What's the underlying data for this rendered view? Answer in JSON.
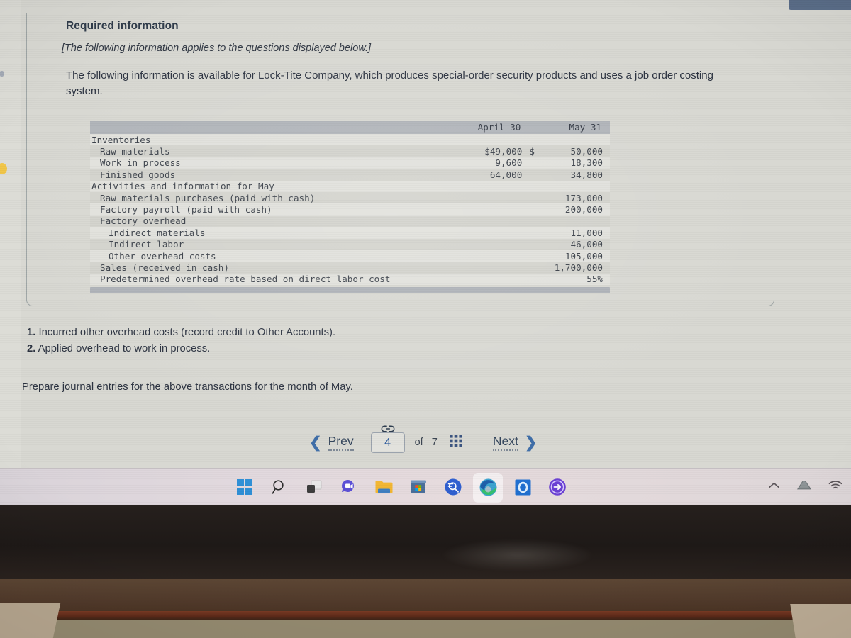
{
  "card": {
    "heading": "Required information",
    "note": "[The following information applies to the questions displayed below.]",
    "body": "The following information is available for Lock-Tite Company, which produces special-order security products and uses a job order costing system."
  },
  "table": {
    "columns": [
      "",
      "April 30",
      "May 31"
    ],
    "rows": [
      {
        "label": "Inventories",
        "indent": 0,
        "april": "",
        "may_currency": "",
        "may": ""
      },
      {
        "label": "Raw materials",
        "indent": 1,
        "april": "$49,000",
        "may_currency": "$",
        "may": "50,000"
      },
      {
        "label": "Work in process",
        "indent": 1,
        "april": "9,600",
        "may_currency": "",
        "may": "18,300"
      },
      {
        "label": "Finished goods",
        "indent": 1,
        "april": "64,000",
        "may_currency": "",
        "may": "34,800"
      },
      {
        "label": "Activities and information for May",
        "indent": 0,
        "april": "",
        "may_currency": "",
        "may": ""
      },
      {
        "label": "Raw materials purchases (paid with cash)",
        "indent": 1,
        "april": "",
        "may_currency": "",
        "may": "173,000"
      },
      {
        "label": "Factory payroll (paid with cash)",
        "indent": 1,
        "april": "",
        "may_currency": "",
        "may": "200,000"
      },
      {
        "label": "Factory overhead",
        "indent": 1,
        "april": "",
        "may_currency": "",
        "may": ""
      },
      {
        "label": "Indirect materials",
        "indent": 2,
        "april": "",
        "may_currency": "",
        "may": "11,000"
      },
      {
        "label": "Indirect labor",
        "indent": 2,
        "april": "",
        "may_currency": "",
        "may": "46,000"
      },
      {
        "label": "Other overhead costs",
        "indent": 2,
        "april": "",
        "may_currency": "",
        "may": "105,000"
      },
      {
        "label": "Sales (received in cash)",
        "indent": 1,
        "april": "",
        "may_currency": "",
        "may": "1,700,000"
      },
      {
        "label": "Predetermined overhead rate based on direct labor cost",
        "indent": 1,
        "april": "",
        "may_currency": "",
        "may": "55%"
      }
    ]
  },
  "instructions": {
    "items": [
      {
        "num": "1.",
        "text": "Incurred other overhead costs (record credit to Other Accounts)."
      },
      {
        "num": "2.",
        "text": "Applied overhead to work in process."
      }
    ],
    "prepare": "Prepare journal entries for the above transactions for the month of May."
  },
  "pager": {
    "prev_label": "Prev",
    "current_page": "4",
    "of_label": "of",
    "total_pages": "7",
    "next_label": "Next",
    "link_icon": "link-icon",
    "grid_icon": "grid-icon",
    "prev_icon": "chevron-left-icon",
    "next_icon": "chevron-right-icon"
  },
  "taskbar": {
    "items": [
      {
        "name": "start-button",
        "icon": "windows-logo-icon"
      },
      {
        "name": "search-button",
        "icon": "search-icon"
      },
      {
        "name": "task-view-button",
        "icon": "task-view-icon"
      },
      {
        "name": "chat-button",
        "icon": "teams-chat-icon"
      },
      {
        "name": "file-explorer-button",
        "icon": "folder-icon"
      },
      {
        "name": "microsoft-store-button",
        "icon": "store-icon"
      },
      {
        "name": "search-app-button",
        "icon": "magnifier-circle-icon"
      },
      {
        "name": "edge-button",
        "icon": "edge-icon",
        "active": true
      },
      {
        "name": "outlook-button",
        "icon": "outlook-icon"
      },
      {
        "name": "app-button",
        "icon": "arrow-circle-icon"
      }
    ],
    "tray": [
      {
        "name": "show-hidden-icons-button",
        "icon": "chevron-up-icon"
      },
      {
        "name": "onedrive-button",
        "icon": "cloud-icon"
      },
      {
        "name": "network-button",
        "icon": "wifi-icon"
      }
    ]
  },
  "colors": {
    "accent_blue": "#2f5d9e",
    "header_bar": "#b0b4b9",
    "page_bg": "#d8d8d2",
    "heading": "#2f3b4a"
  }
}
